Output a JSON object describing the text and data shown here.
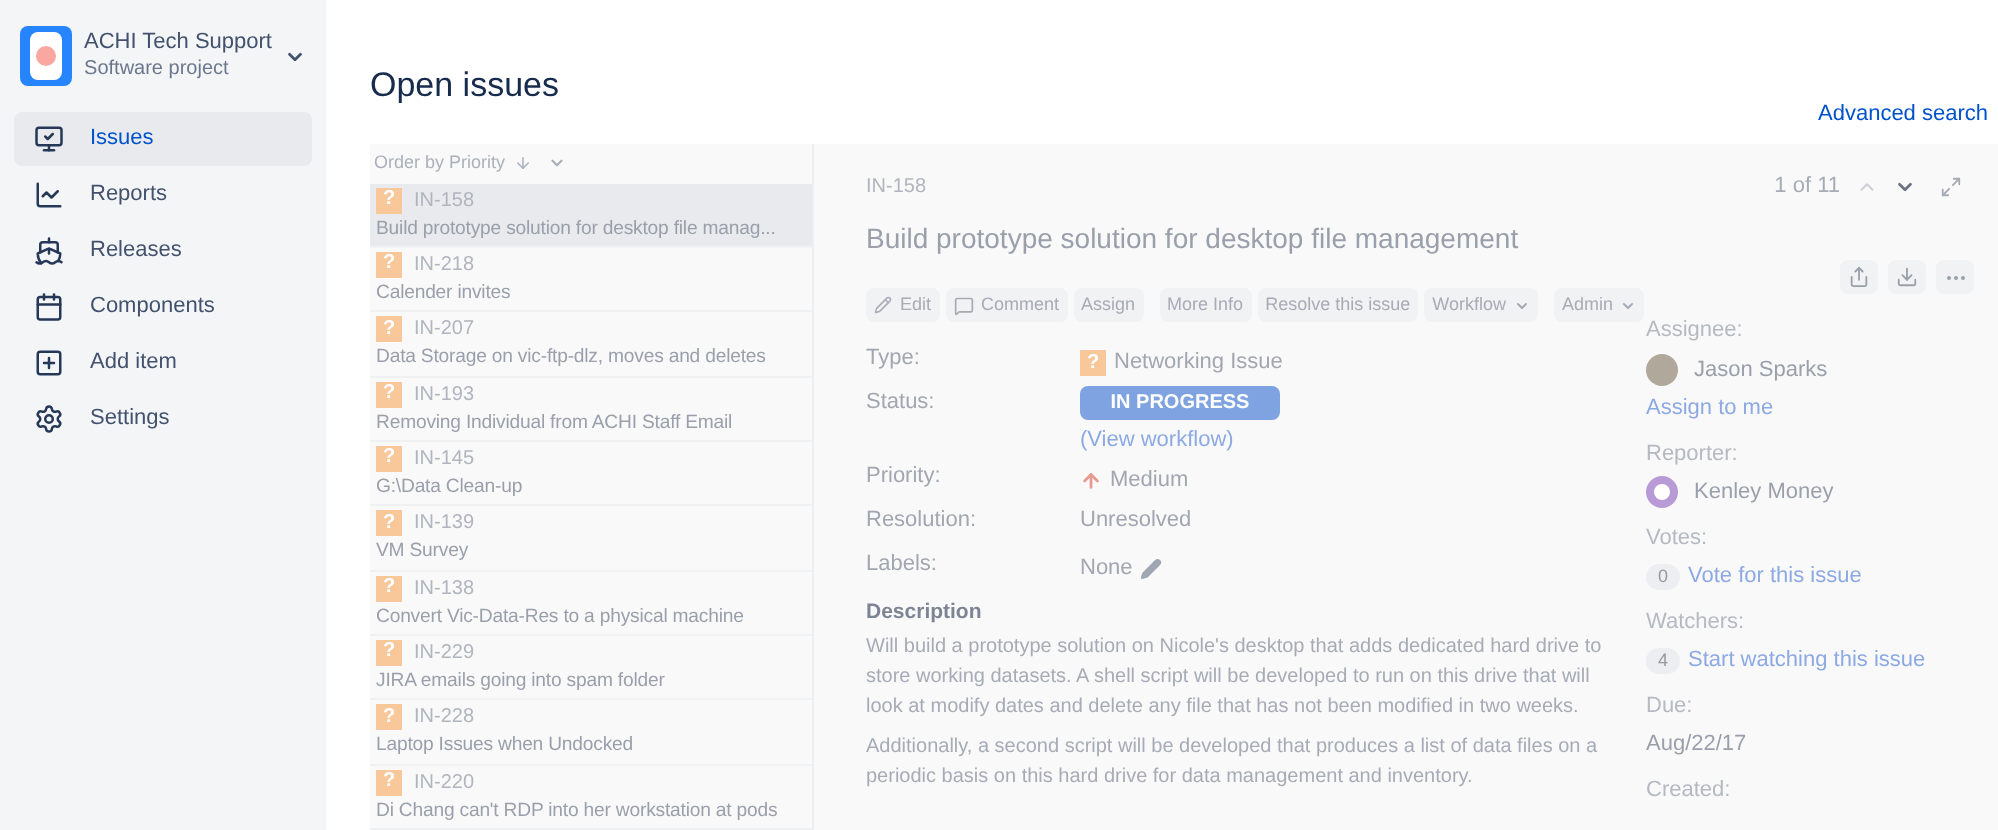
{
  "project": {
    "name": "ACHI Tech Support",
    "type": "Software project"
  },
  "nav": [
    {
      "label": "Issues",
      "selected": true
    },
    {
      "label": "Reports",
      "selected": false
    },
    {
      "label": "Releases",
      "selected": false
    },
    {
      "label": "Components",
      "selected": false
    },
    {
      "label": "Add item",
      "selected": false
    },
    {
      "label": "Settings",
      "selected": false
    }
  ],
  "page_title": "Open issues",
  "advanced_search": "Advanced search",
  "order_by": "Order by Priority",
  "issues": [
    {
      "type_icon": "?",
      "key": "IN-158",
      "summary": "Build prototype solution for desktop file manag...",
      "selected": true
    },
    {
      "type_icon": "?",
      "key": "IN-218",
      "summary": "Calender invites",
      "selected": false
    },
    {
      "type_icon": "?",
      "key": "IN-207",
      "summary": "Data Storage on vic-ftp-dlz, moves and deletes",
      "selected": false
    },
    {
      "type_icon": "?",
      "key": "IN-193",
      "summary": "Removing Individual from ACHI Staff Email",
      "selected": false
    },
    {
      "type_icon": "?",
      "key": "IN-145",
      "summary": "G:\\Data Clean-up",
      "selected": false
    },
    {
      "type_icon": "?",
      "key": "IN-139",
      "summary": "VM Survey",
      "selected": false
    },
    {
      "type_icon": "?",
      "key": "IN-138",
      "summary": "Convert Vic-Data-Res to a physical machine",
      "selected": false
    },
    {
      "type_icon": "?",
      "key": "IN-229",
      "summary": "JIRA emails going into spam folder",
      "selected": false
    },
    {
      "type_icon": "?",
      "key": "IN-228",
      "summary": "Laptop Issues when Undocked",
      "selected": false
    },
    {
      "type_icon": "?",
      "key": "IN-220",
      "summary": "Di Chang can't RDP into her workstation at pods",
      "selected": false
    }
  ],
  "detail": {
    "key": "IN-158",
    "title": "Build prototype solution for desktop file management",
    "pager": "1 of 11",
    "actions": [
      {
        "label": "Edit",
        "kind": "edit"
      },
      {
        "label": "Comment",
        "kind": "comment"
      },
      {
        "label": "Assign",
        "kind": "plain"
      },
      {
        "label": "More Info",
        "kind": "plain"
      },
      {
        "label": "Resolve this issue",
        "kind": "plain"
      },
      {
        "label": "Workflow",
        "kind": "menu"
      },
      {
        "label": "Admin",
        "kind": "menu"
      }
    ],
    "fields": [
      {
        "label": "Type:",
        "value": "Networking Issue",
        "kind": "type",
        "type_icon": "?"
      },
      {
        "label": "Status:",
        "value": "IN PROGRESS",
        "kind": "status",
        "link": "(View workflow)"
      },
      {
        "label": "Priority:",
        "value": "Medium",
        "kind": "priority"
      },
      {
        "label": "Resolution:",
        "value": "Unresolved",
        "kind": "text"
      },
      {
        "label": "Labels:",
        "value": "None",
        "kind": "labels"
      }
    ],
    "description_heading": "Description",
    "description": [
      "Will build a prototype solution on Nicole's desktop that adds dedicated hard drive to store working datasets. A shell script will be developed to run on this drive that will look at modify dates and delete any file that has not been modified in two weeks.",
      "Additionally, a second script will be developed that produces a list of data files on a periodic basis on this hard drive for data management and inventory."
    ],
    "people": [
      {
        "label": "Assignee:",
        "kind": "person",
        "name": "Jason Sparks",
        "link": "Assign to me"
      },
      {
        "label": "Reporter:",
        "kind": "person",
        "name": "Kenley Money"
      },
      {
        "label": "Votes:",
        "kind": "count",
        "count": "0",
        "link": "Vote for this issue"
      },
      {
        "label": "Watchers:",
        "kind": "count",
        "count": "4",
        "link": "Start watching this issue"
      },
      {
        "label": "Due:",
        "kind": "text",
        "value": "Aug/22/17"
      },
      {
        "label": "Created:",
        "kind": "label"
      }
    ]
  }
}
